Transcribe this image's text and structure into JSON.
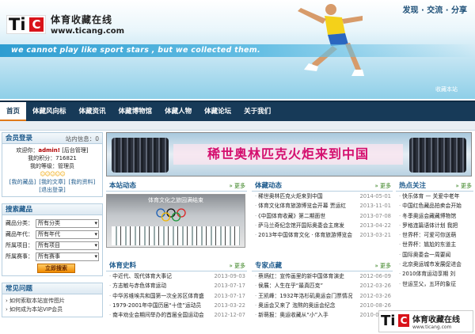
{
  "header": {
    "logo_letters": "Ti",
    "logo_c": "C",
    "site_name": "体育收藏在线",
    "site_url": "www.ticang.com",
    "slogan_top": "发现 · 交流 · 分享",
    "slogan_en": "we cannot play like sport stars , but we collected them.",
    "collect_link": "收藏本站"
  },
  "nav": {
    "items": [
      "首页",
      "体藏风向标",
      "体藏资讯",
      "体藏博物馆",
      "体藏人物",
      "体藏论坛",
      "关于我们"
    ]
  },
  "member": {
    "title": "会员登录",
    "extra": "站内信息：0",
    "welcome_prefix": "欢迎你：",
    "username": "admin!",
    "admin_link": "[后台管理]",
    "points": "我的积分：716821",
    "level": "我的等级：管理员",
    "stars": "☺☺☺☺☺",
    "links": [
      "[我的藏品]",
      "[我的文章]",
      "[我的资料]",
      "[退出登录]"
    ]
  },
  "search": {
    "title": "搜索藏品",
    "rows": [
      {
        "label": "藏品分类：",
        "value": "所有分类"
      },
      {
        "label": "藏品年代：",
        "value": "所有年代"
      },
      {
        "label": "所属项目：",
        "value": "所有项目"
      },
      {
        "label": "所属赛事：",
        "value": "所有赛事"
      }
    ],
    "button": "立即搜索"
  },
  "faq": {
    "title": "常见问题",
    "items": [
      "› 如何索取本站宣传图片",
      "› 如何成为本站VIP会员"
    ]
  },
  "banner": {
    "text": "稀世奥林匹克火炬来到中国"
  },
  "site_news": {
    "title": "本站动态",
    "more": "» 更多",
    "photo_caption": "体育文化之旅园满结束"
  },
  "tizang_news": {
    "title": "体藏动态",
    "more": "» 更多",
    "items": [
      {
        "t": "稀世奥林匹克火炬来到中国",
        "d": "2014-05-01"
      },
      {
        "t": "体育文化体育旅游博览会开幕 贾运红",
        "d": "2013-11-01"
      },
      {
        "t": "《中国体育收藏》第二期面世",
        "d": "2013-07-08"
      },
      {
        "t": "萨马兰奇纪念馆开国际奥委会主席发",
        "d": "2013-04-22"
      },
      {
        "t": "2013年中国体育文化 · 体育旅游博览会",
        "d": "2013-03-21"
      }
    ]
  },
  "hot": {
    "title": "热点关注",
    "more": "» 更多",
    "items": [
      "快乐体育 — 关爱中老年",
      "中国红色藏品拍卖会开始",
      "冬季奥运会藏藏博物馆",
      "罗格连篇语体计划 我把",
      "世界杯：可爱可你送萌",
      "世界杯：尴尬的东道主",
      "国际奥委会一周要闻",
      "北京奥运城市发展促进会",
      "2010体育运动享期 刘",
      "世运至父，五环的象征"
    ]
  },
  "history": {
    "title": "体育史料",
    "more": "» 更多",
    "items": [
      {
        "t": "中近代、现代体育大事记",
        "d": "2013-09-03"
      },
      {
        "t": "方志敏与赤色体育运动",
        "d": "2013-07-17"
      },
      {
        "t": "中华苏维埃共和国第一次全苏区体育盛",
        "d": "2013-07-17"
      },
      {
        "t": "1979-2001年中国历届“十佳”运动员",
        "d": "2013-03-22"
      },
      {
        "t": "南丰劝业会期间举办的首届全国运动会",
        "d": "2012-12-07"
      }
    ]
  },
  "experts": {
    "title": "专家点藏",
    "more": "» 更多",
    "items": [
      {
        "t": "蔡炳红：宣传画里的新中国体育演史",
        "d": "2012-06-09"
      },
      {
        "t": "侯展：人生在乎“最真匹克”",
        "d": "2012-03-26"
      },
      {
        "t": "王凯峰：1932年洛杉矶奥运会门票情况",
        "d": "2012-03-26"
      },
      {
        "t": "奥运会又来了 泡熬的奥运会纪念",
        "d": "2010-08-26"
      },
      {
        "t": "新萌报：奥运收藏从“小”入手",
        "d": "2010-08-26"
      }
    ]
  },
  "watermark": {
    "letters": "Ti",
    "c": "C",
    "cn": "体育收藏在线",
    "url": "www.ticang.com"
  }
}
